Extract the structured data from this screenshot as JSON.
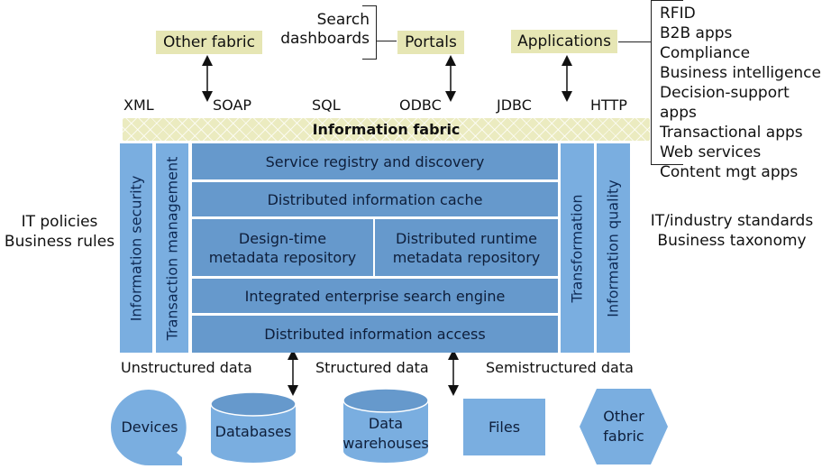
{
  "top": {
    "other_fabric": "Other fabric",
    "search_dashboards": [
      "Search",
      "dashboards"
    ],
    "portals": "Portals",
    "applications": "Applications",
    "application_types": [
      "RFID",
      "B2B apps",
      "Compliance",
      "Business intelligence",
      "Decision-support apps",
      "Transactional apps",
      "Web services",
      "Content mgt apps"
    ]
  },
  "protocols": [
    "XML",
    "SOAP",
    "SQL",
    "ODBC",
    "JDBC",
    "HTTP"
  ],
  "information_fabric": "Information fabric",
  "left_columns": [
    "Information security",
    "Transaction management"
  ],
  "right_columns": [
    "Transformation",
    "Information quality"
  ],
  "layers": {
    "service_registry": "Service registry and discovery",
    "cache": "Distributed information cache",
    "design_time_repo": [
      "Design-time",
      "metadata repository"
    ],
    "runtime_repo": [
      "Distributed runtime",
      "metadata repository"
    ],
    "search_engine": "Integrated enterprise search engine",
    "access": "Distributed information access"
  },
  "left_side": [
    "IT policies",
    "Business rules"
  ],
  "right_side": [
    "IT/industry standards",
    "Business taxonomy"
  ],
  "data_types": [
    "Unstructured data",
    "Structured data",
    "Semistructured data"
  ],
  "sources": {
    "devices": "Devices",
    "databases": "Databases",
    "data_warehouses": [
      "Data",
      "warehouses"
    ],
    "files": "Files",
    "other_fabric": [
      "Other",
      "fabric"
    ]
  },
  "colors": {
    "tag_fill": "#e6e6b4",
    "core_blue": "#6699cc",
    "side_blue": "#7aaee0",
    "source_blue": "#7aaee0"
  }
}
